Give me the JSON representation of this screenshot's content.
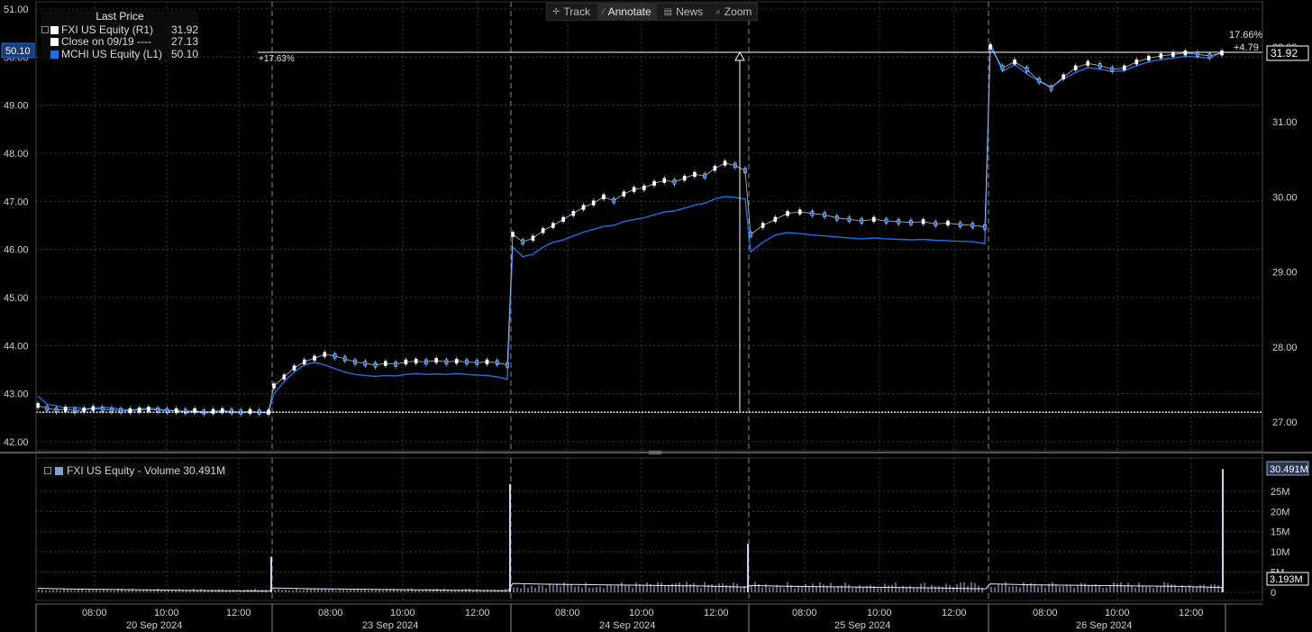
{
  "toolbar": {
    "items": [
      {
        "icon": "crosshair-icon",
        "glyph": "✛",
        "label": "Track"
      },
      {
        "icon": "pencil-icon",
        "glyph": "∕",
        "label": "Annotate"
      },
      {
        "icon": "news-icon",
        "glyph": "▤",
        "label": "News"
      },
      {
        "icon": "magnifier-icon",
        "glyph": "⌕",
        "label": "Zoom"
      }
    ],
    "active": "Annotate"
  },
  "legend": {
    "title": "Last Price",
    "rows": [
      {
        "name": "FXI US Equity  (R1)",
        "value": "31.92",
        "color": "#ffffff"
      },
      {
        "name": "Close on 09/19 ----",
        "value": "27.13",
        "color": "#ffffff"
      },
      {
        "name": "MCHI US Equity  (L1)",
        "value": "50.10",
        "color": "#1e6fe0"
      }
    ]
  },
  "volume_legend": {
    "label": "FXI US Equity - Volume 30.491M"
  },
  "chart_data": [
    {
      "type": "line",
      "left_axis": {
        "ticks": [
          "51.00",
          "50.00",
          "49.00",
          "48.00",
          "47.00",
          "46.00",
          "45.00",
          "44.00",
          "43.00",
          "42.00"
        ],
        "range": [
          42,
          51
        ],
        "current_label": "50.10"
      },
      "right_axis": {
        "ticks": [
          "32.00",
          "31.00",
          "30.00",
          "29.00",
          "28.00",
          "27.00"
        ],
        "range": [
          26.5,
          32.4
        ],
        "current_label": "31.92"
      },
      "x_axis": {
        "time_ticks": [
          "08:00",
          "10:00",
          "12:00",
          "08:00",
          "10:00",
          "12:00",
          "08:00",
          "10:00",
          "12:00",
          "08:00",
          "10:00",
          "12:00",
          "08:00",
          "10:00",
          "12:00"
        ],
        "date_ticks": [
          "20 Sep 2024",
          "23 Sep 2024",
          "24 Sep 2024",
          "25 Sep 2024",
          "26 Sep 2024"
        ]
      },
      "series": [
        {
          "name": "FXI US Equity",
          "axis": "right",
          "color": "#ffffff",
          "style": "candlestick",
          "days": [
            {
              "values": [
                27.22,
                27.18,
                27.16,
                27.17,
                27.15,
                27.16,
                27.18,
                27.17,
                27.16,
                27.15,
                27.15,
                27.16,
                27.17,
                27.16,
                27.15,
                27.15,
                27.14,
                27.15,
                27.13,
                27.14,
                27.15,
                27.14,
                27.13,
                27.14,
                27.13,
                27.13
              ]
            },
            {
              "values": [
                27.48,
                27.6,
                27.72,
                27.8,
                27.85,
                27.9,
                27.88,
                27.84,
                27.8,
                27.78,
                27.76,
                27.78,
                27.77,
                27.8,
                27.81,
                27.8,
                27.82,
                27.8,
                27.81,
                27.8,
                27.79,
                27.8,
                27.79,
                27.76
              ]
            },
            {
              "values": [
                29.5,
                29.4,
                29.45,
                29.55,
                29.62,
                29.7,
                29.78,
                29.86,
                29.92,
                30.0,
                29.95,
                30.04,
                30.1,
                30.12,
                30.18,
                30.22,
                30.2,
                30.25,
                30.3,
                30.28,
                30.38,
                30.45,
                30.42,
                30.35
              ]
            },
            {
              "values": [
                29.5,
                29.62,
                29.7,
                29.78,
                29.8,
                29.78,
                29.76,
                29.72,
                29.7,
                29.68,
                29.7,
                29.68,
                29.67,
                29.66,
                29.67,
                29.64,
                29.65,
                29.63,
                29.62,
                29.6
              ]
            },
            {
              "values": [
                32.0,
                31.72,
                31.8,
                31.7,
                31.55,
                31.45,
                31.6,
                31.72,
                31.78,
                31.75,
                31.7,
                31.72,
                31.8,
                31.85,
                31.88,
                31.9,
                31.92,
                31.9,
                31.88,
                31.92
              ]
            }
          ]
        },
        {
          "name": "MCHI US Equity",
          "axis": "left",
          "color": "#1e6fe0",
          "style": "line",
          "days": [
            {
              "values": [
                42.95,
                42.78,
                42.75,
                42.7,
                42.72,
                42.68,
                42.7,
                42.72,
                42.7,
                42.68,
                42.66,
                42.68,
                42.7,
                42.68,
                42.66,
                42.65,
                42.62,
                42.63,
                42.6,
                42.62,
                42.63,
                42.62,
                42.6,
                42.62,
                42.61,
                42.6
              ]
            },
            {
              "values": [
                43.0,
                43.25,
                43.45,
                43.6,
                43.65,
                43.6,
                43.52,
                43.45,
                43.4,
                43.38,
                43.36,
                43.38,
                43.37,
                43.4,
                43.42,
                43.4,
                43.41,
                43.4,
                43.42,
                43.4,
                43.39,
                43.38,
                43.35,
                43.3
              ]
            },
            {
              "values": [
                46.05,
                45.85,
                45.9,
                46.05,
                46.15,
                46.2,
                46.28,
                46.36,
                46.42,
                46.48,
                46.5,
                46.58,
                46.62,
                46.66,
                46.72,
                46.78,
                46.8,
                46.86,
                46.92,
                46.96,
                47.05,
                47.1,
                47.08,
                47.05
              ]
            },
            {
              "values": [
                45.95,
                46.15,
                46.3,
                46.35,
                46.33,
                46.3,
                46.28,
                46.26,
                46.24,
                46.22,
                46.24,
                46.22,
                46.21,
                46.2,
                46.21,
                46.19,
                46.18,
                46.17,
                46.16,
                46.12
              ]
            },
            {
              "values": [
                50.3,
                49.7,
                49.85,
                49.65,
                49.5,
                49.38,
                49.55,
                49.68,
                49.78,
                49.75,
                49.7,
                49.72,
                49.82,
                49.9,
                49.95,
                49.98,
                50.02,
                50.0,
                49.98,
                50.1
              ]
            }
          ]
        },
        {
          "name": "Close on 09/19",
          "axis": "right",
          "value": 27.13,
          "color": "#ffffff",
          "style": "dotted"
        }
      ],
      "annotation": {
        "label": "+17.63%",
        "from": 27.13,
        "to": 31.9
      },
      "right_annotation": {
        "pct": "17.66%",
        "abs": "+4.79"
      }
    },
    {
      "type": "bar",
      "title": "FXI US Equity - Volume",
      "y_axis": {
        "ticks": [
          "25M",
          "20M",
          "15M",
          "10M",
          "5M",
          "0"
        ],
        "range_millions": [
          0,
          31
        ]
      },
      "current_label": "30.491M",
      "avg_label": "3.193M",
      "spikes_millions": [
        {
          "day": 1,
          "position": "open",
          "value": 2.9
        },
        {
          "day": 2,
          "position": "open",
          "value": 8.8
        },
        {
          "day": 3,
          "position": "open",
          "value": 26.8
        },
        {
          "day": 4,
          "position": "open",
          "value": 12.0
        },
        {
          "day": 5,
          "position": "close",
          "value": 30.491
        }
      ]
    }
  ]
}
